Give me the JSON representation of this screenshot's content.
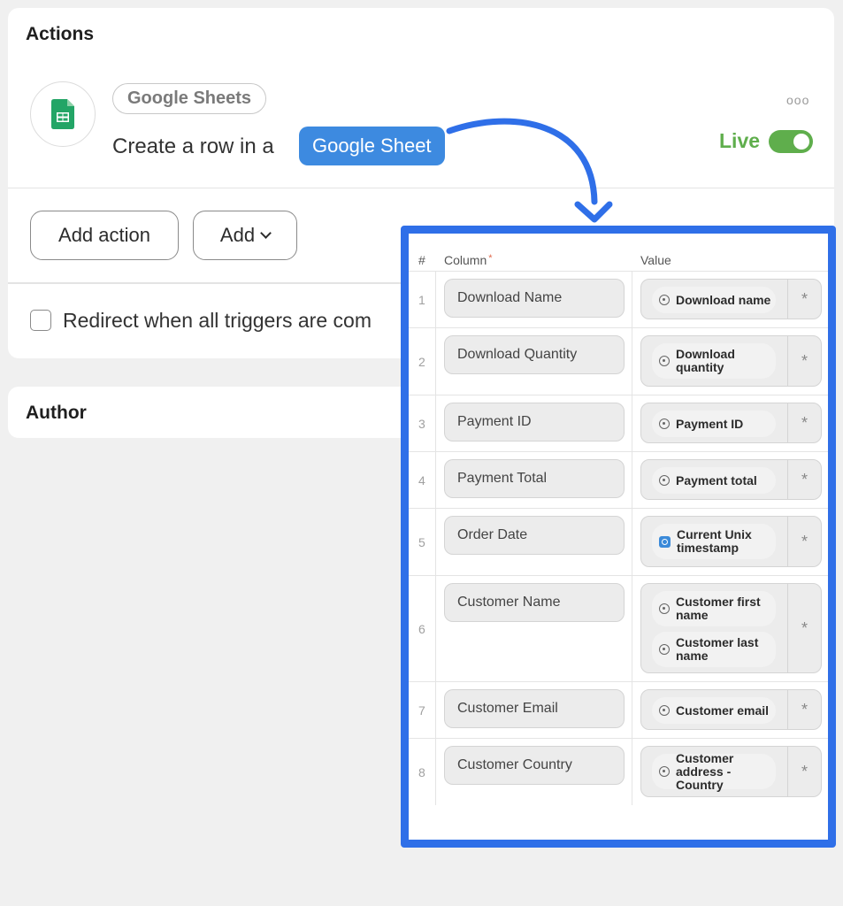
{
  "actions_card": {
    "title": "Actions",
    "app_pill": "Google Sheets",
    "description": "Create a row in a",
    "target_pill": "Google Sheet",
    "more": "ooo",
    "status_label": "Live",
    "status_on": true,
    "add_action_label": "Add action",
    "add_label": "Add",
    "redirect_label": "Redirect when all triggers are com"
  },
  "author_card": {
    "title": "Author"
  },
  "mapping_table": {
    "headers": {
      "index": "#",
      "column": "Column",
      "required_mark": "*",
      "value": "Value"
    },
    "rows": [
      {
        "index": "1",
        "column": "Download Name",
        "values": [
          {
            "icon": "generic-field-icon",
            "label": "Download name"
          }
        ],
        "star": "*"
      },
      {
        "index": "2",
        "column": "Download Quantity",
        "values": [
          {
            "icon": "generic-field-icon",
            "label": "Download quantity"
          }
        ],
        "star": "*"
      },
      {
        "index": "3",
        "column": "Payment ID",
        "values": [
          {
            "icon": "generic-field-icon",
            "label": "Payment ID"
          }
        ],
        "star": "*"
      },
      {
        "index": "4",
        "column": "Payment Total",
        "values": [
          {
            "icon": "generic-field-icon",
            "label": "Payment total"
          }
        ],
        "star": "*"
      },
      {
        "index": "5",
        "column": "Order Date",
        "values": [
          {
            "icon": "clock-icon",
            "label": "Current Unix timestamp"
          }
        ],
        "star": "*"
      },
      {
        "index": "6",
        "column": "Customer Name",
        "values": [
          {
            "icon": "generic-field-icon",
            "label": "Customer first name"
          },
          {
            "icon": "generic-field-icon",
            "label": "Customer last name"
          }
        ],
        "star": "*"
      },
      {
        "index": "7",
        "column": "Customer Email",
        "values": [
          {
            "icon": "generic-field-icon",
            "label": "Customer email"
          }
        ],
        "star": "*"
      },
      {
        "index": "8",
        "column": "Customer Country",
        "values": [
          {
            "icon": "generic-field-icon",
            "label": "Customer address - Country"
          }
        ],
        "star": "*"
      }
    ]
  },
  "colors": {
    "accent_blue": "#3d8ae0",
    "overlay_border": "#2f6fe8",
    "live_green": "#5fae4c",
    "sheets_green": "#23a566"
  }
}
